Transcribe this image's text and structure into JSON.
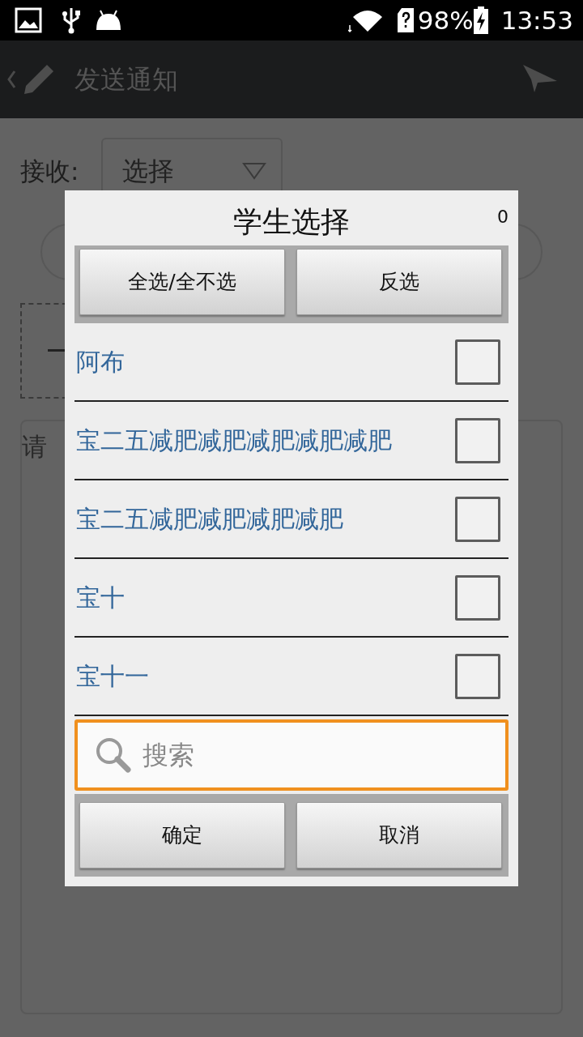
{
  "status_bar": {
    "battery": "98%",
    "time": "13:53"
  },
  "action_bar": {
    "title": "发送通知"
  },
  "form": {
    "receiver_label": "接收:",
    "receiver_dropdown": "选择",
    "message_placeholder": "请"
  },
  "dialog": {
    "title": "学生选择",
    "count": "0",
    "top_buttons": [
      "全选/全不选",
      "反选"
    ],
    "students": [
      {
        "name": "阿布",
        "checked": false
      },
      {
        "name": "宝二五减肥减肥减肥减肥减肥",
        "checked": false
      },
      {
        "name": "宝二五减肥减肥减肥减肥",
        "checked": false
      },
      {
        "name": "宝十",
        "checked": false
      },
      {
        "name": "宝十一",
        "checked": false
      }
    ],
    "search": {
      "placeholder": "搜索"
    },
    "bottom_buttons": [
      "确定",
      "取消"
    ]
  }
}
